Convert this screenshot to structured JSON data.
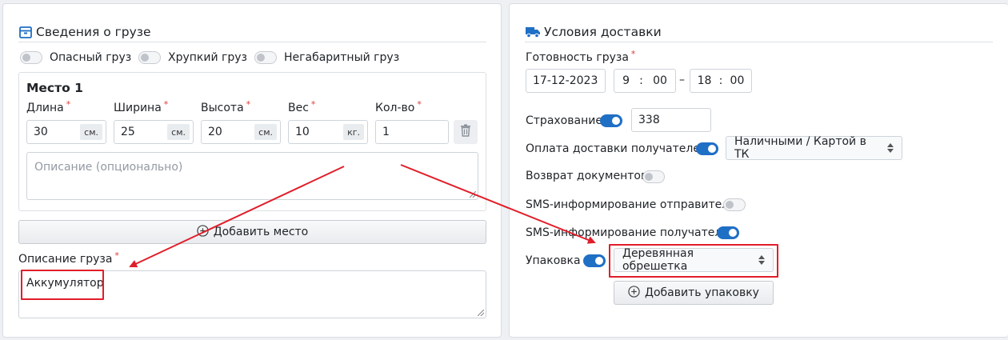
{
  "cargo": {
    "title": "Сведения о грузе",
    "toggles": [
      {
        "label": "Опасный груз",
        "on": false
      },
      {
        "label": "Хрупкий груз",
        "on": false
      },
      {
        "label": "Негабаритный груз",
        "on": false
      }
    ],
    "place": {
      "title": "Место 1",
      "length": {
        "label": "Длина",
        "value": "30",
        "unit": "см."
      },
      "width": {
        "label": "Ширина",
        "value": "25",
        "unit": "см."
      },
      "height": {
        "label": "Высота",
        "value": "20",
        "unit": "см."
      },
      "weight": {
        "label": "Вес",
        "value": "10",
        "unit": "кг."
      },
      "qty": {
        "label": "Кол-во",
        "value": "1"
      },
      "description_placeholder": "Описание (опционально)"
    },
    "add_place_label": "Добавить место",
    "description_label": "Описание груза",
    "description_value": "Аккумулятор",
    "required_mark": "*"
  },
  "delivery": {
    "title": "Условия доставки",
    "ready_label": "Готовность груза",
    "ready_date": "17-12-2023",
    "time_from_h": "9",
    "time_from_m": "00",
    "time_sep": ":",
    "range_sep": "–",
    "time_to_h": "18",
    "time_to_m": "00",
    "insurance_label": "Страхование",
    "insurance_on": true,
    "insurance_value": "338",
    "payment_label": "Оплата доставки получателем",
    "payment_on": true,
    "payment_method": "Наличными / Картой в ТК",
    "return_docs_label": "Возврат документов",
    "return_docs_on": false,
    "sms_sender_label": "SMS-информирование отправителя",
    "sms_sender_on": false,
    "sms_recipient_label": "SMS-информирование получателя",
    "sms_recipient_on": true,
    "packing_label": "Упаковка",
    "packing_on": true,
    "packing_value": "Деревянная обрешетка",
    "add_packing_label": "Добавить упаковку"
  },
  "colors": {
    "accent": "#1f6fc5",
    "annotation": "#e01e2a"
  }
}
